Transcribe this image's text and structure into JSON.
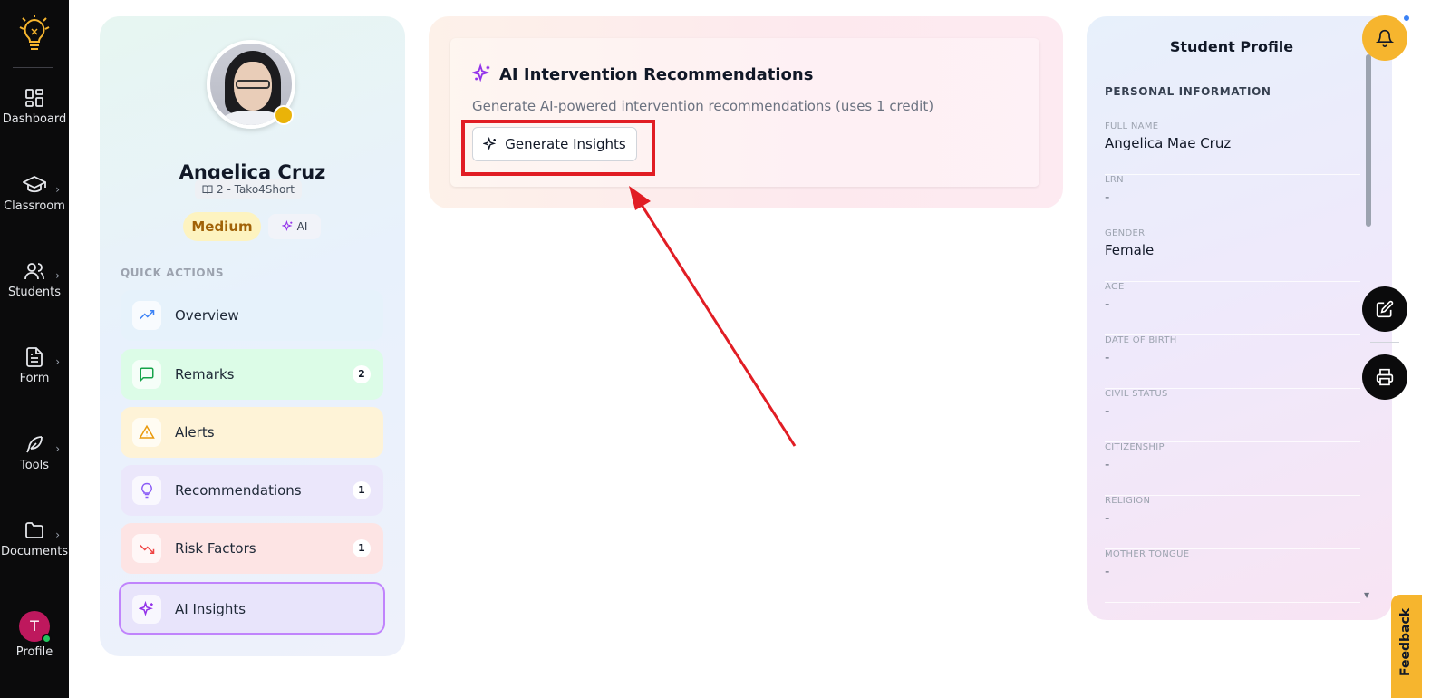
{
  "nav": {
    "items": [
      {
        "label": "Dashboard",
        "icon": "dashboard-icon"
      },
      {
        "label": "Classroom",
        "icon": "graduation-cap-icon"
      },
      {
        "label": "Students",
        "icon": "users-icon"
      },
      {
        "label": "Form",
        "icon": "file-text-icon"
      },
      {
        "label": "Tools",
        "icon": "feather-icon"
      },
      {
        "label": "Documents",
        "icon": "folder-icon"
      }
    ],
    "profile_label": "Profile",
    "profile_initial": "T"
  },
  "student_card": {
    "name": "Angelica Cruz",
    "class": "2 - Tako4Short",
    "risk_level": "Medium",
    "ai_badge": "AI",
    "quick_actions_title": "QUICK ACTIONS",
    "actions": [
      {
        "label": "Overview",
        "count": null
      },
      {
        "label": "Remarks",
        "count": "2"
      },
      {
        "label": "Alerts",
        "count": null
      },
      {
        "label": "Recommendations",
        "count": "1"
      },
      {
        "label": "Risk Factors",
        "count": "1"
      },
      {
        "label": "AI Insights",
        "count": null
      }
    ]
  },
  "ai_panel": {
    "title": "AI Intervention Recommendations",
    "description": "Generate AI-powered intervention recommendations (uses 1 credit)",
    "button_label": "Generate Insights"
  },
  "profile_panel": {
    "title": "Student Profile",
    "section": "PERSONAL INFORMATION",
    "fields": [
      {
        "label": "FULL NAME",
        "value": "Angelica Mae Cruz"
      },
      {
        "label": "LRN",
        "value": "-"
      },
      {
        "label": "GENDER",
        "value": "Female"
      },
      {
        "label": "AGE",
        "value": "-"
      },
      {
        "label": "DATE OF BIRTH",
        "value": "-"
      },
      {
        "label": "CIVIL STATUS",
        "value": "-"
      },
      {
        "label": "CITIZENSHIP",
        "value": "-"
      },
      {
        "label": "RELIGION",
        "value": "-"
      },
      {
        "label": "MOTHER TONGUE",
        "value": "-"
      }
    ]
  },
  "feedback_label": "Feedback",
  "colors": {
    "accent_yellow": "#f6b52e",
    "highlight_red": "#e11d24",
    "ai_purple": "#9333ea"
  }
}
